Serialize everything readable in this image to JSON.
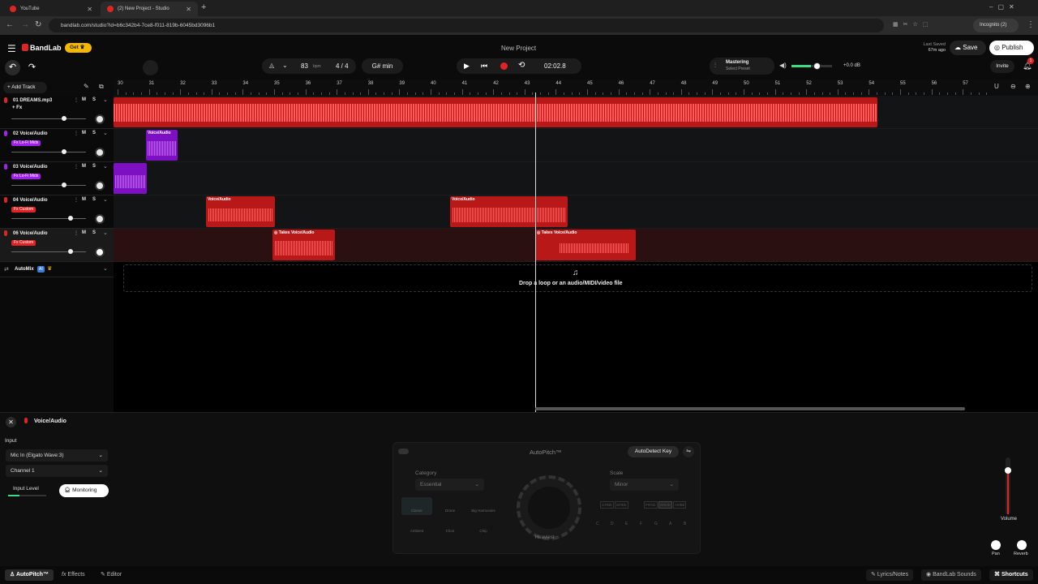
{
  "browser": {
    "tabs": [
      {
        "title": "YouTube"
      },
      {
        "title": "(2) New Project - Studio"
      }
    ],
    "url": "bandlab.com/studio?id=b6c342b4-7ce8-f011-819b-6045bd3096b1",
    "profile": "Incognito (2)"
  },
  "header": {
    "logo": "BandLab",
    "get_label": "Get",
    "project_title": "New Project",
    "last_saved_label": "Last Saved",
    "last_saved_time": "67m ago",
    "save_label": "Save",
    "publish_label": "Publish",
    "invite_label": "Invite",
    "notification_count": "1"
  },
  "transport": {
    "bpm": "83",
    "bpm_unit": "bpm",
    "time_sig": "4 / 4",
    "key": "G# min",
    "time": "02:02.8",
    "mastering_label": "Mastering",
    "mastering_preset": "Select Preset",
    "master_db": "+0.0 dB"
  },
  "tracks_header": {
    "add_track_label": "Add Track"
  },
  "ruler": [
    "30",
    "31",
    "32",
    "33",
    "34",
    "35",
    "36",
    "37",
    "38",
    "39",
    "40",
    "41",
    "42",
    "43",
    "44",
    "45",
    "46",
    "47",
    "48",
    "49",
    "50",
    "51",
    "52",
    "53",
    "54",
    "55",
    "56",
    "57"
  ],
  "tracks": [
    {
      "name": "01  DREAMS.mp3",
      "fx": "+ Fx",
      "m": "M",
      "s": "S",
      "color": "#e02424"
    },
    {
      "name": "02  Voice/Audio",
      "fx": "Fx  Lo-Fi Mids",
      "m": "M",
      "s": "S",
      "color": "#a020f0"
    },
    {
      "name": "03  Voice/Audio",
      "fx": "Fx  Lo-Fi Mids",
      "m": "M",
      "s": "S",
      "color": "#a020f0"
    },
    {
      "name": "04  Voice/Audio",
      "fx": "Fx  Custom",
      "m": "M",
      "s": "S",
      "color": "#e02424"
    },
    {
      "name": "06  Voice/Audio",
      "fx": "Fx  Custom",
      "m": "M",
      "s": "S",
      "color": "#e02424"
    }
  ],
  "clips": {
    "voice_audio": "Voice/Audio",
    "takes": "Takes"
  },
  "automix": {
    "label": "AutoMix",
    "ai_badge": "AI"
  },
  "drop_zone": {
    "text": "Drop a loop or an audio/MIDI/video file"
  },
  "editor": {
    "track_name": "Voice/Audio",
    "input_label": "Input",
    "input_device": "Mic In (Elgato Wave:3)",
    "channel": "Channel 1",
    "input_level_label": "Input Level",
    "monitoring_label": "Monitoring",
    "autopitch_title": "AutoPitch™",
    "autodetect_label": "AutoDetect Key",
    "category_label": "Category",
    "category_value": "Essential",
    "scale_label": "Scale",
    "scale_value": "Minor",
    "presets": [
      "Classic",
      "Drone",
      "Big Harmonies",
      "Ambient",
      "Choir",
      "Chip"
    ],
    "knob_label": "Heaviest",
    "chromatic_top": [
      "C#/Db",
      "D#/Eb",
      "F#/Gb",
      "G#/Ab",
      "A#/Bb"
    ],
    "chromatic_bottom": [
      "C",
      "D",
      "E",
      "F",
      "G",
      "A",
      "B"
    ],
    "volume_label": "Volume",
    "pan_label": "Pan",
    "reverb_label": "Reverb"
  },
  "bottom_tabs": {
    "autopitch": "AutoPitch™",
    "effects": "Effects",
    "editor": "Editor",
    "lyrics": "Lyrics/Notes",
    "sounds": "BandLab Sounds",
    "shortcuts": "Shortcuts"
  },
  "colors": {
    "accent_red": "#e02424",
    "purple": "#a020f0",
    "bg": "#000000"
  }
}
